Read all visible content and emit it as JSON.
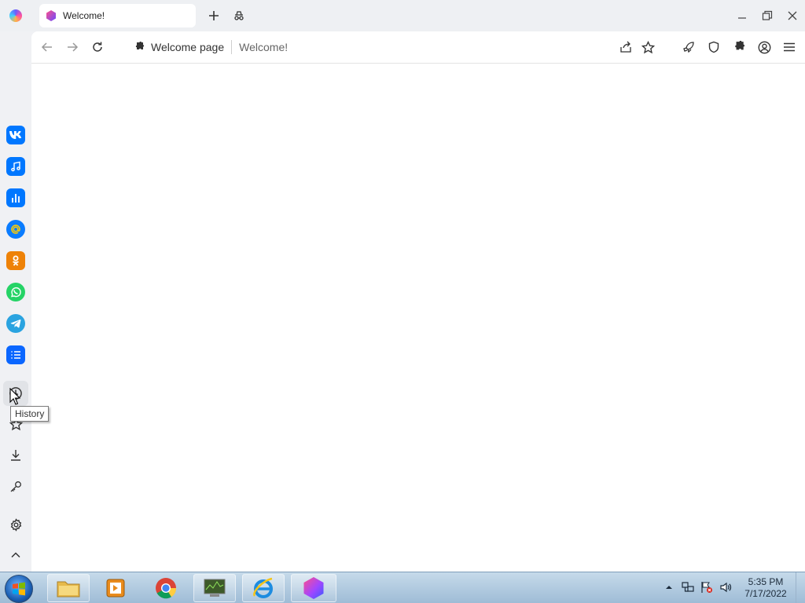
{
  "tab": {
    "title": "Welcome!"
  },
  "address_bar": {
    "site_label": "Welcome page",
    "page_title": "Welcome!"
  },
  "sidebar": {
    "apps": [
      {
        "name": "VK",
        "icon": "vk-icon",
        "color": "#0077ff"
      },
      {
        "name": "VK Music",
        "icon": "music-icon",
        "color": "#0077ff"
      },
      {
        "name": "Stats",
        "icon": "bar-chart-icon",
        "color": "#0077ff"
      },
      {
        "name": "Mail",
        "icon": "at-sign-icon",
        "color": "#0a7cff"
      },
      {
        "name": "Odnoklassniki",
        "icon": "ok-icon",
        "color": "#ee8208"
      },
      {
        "name": "WhatsApp",
        "icon": "whatsapp-icon",
        "color": "#25d366"
      },
      {
        "name": "Telegram",
        "icon": "telegram-icon",
        "color": "#2aa3e0"
      },
      {
        "name": "Lists",
        "icon": "list-icon",
        "color": "#0a66ff"
      }
    ],
    "tools": [
      "history-icon",
      "bookmarks-icon",
      "downloads-icon",
      "passwords-icon",
      "settings-icon",
      "collapse-icon"
    ],
    "tooltip": "History"
  },
  "taskbar": {
    "time": "5:35 PM",
    "date": "7/17/2022"
  }
}
